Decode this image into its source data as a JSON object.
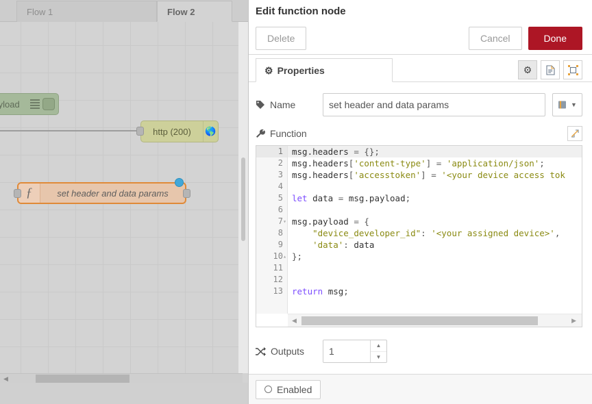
{
  "canvas": {
    "tabs": [
      {
        "label": "Flow 1",
        "active": false
      },
      {
        "label": "Flow 2",
        "active": true
      }
    ],
    "nodes": {
      "debug": {
        "label": "msg.payload",
        "icon": "debug-lines-icon",
        "color": "#a5b99a"
      },
      "http": {
        "label": "http (200)",
        "icon": "globe-icon",
        "color": "#cdd09a"
      },
      "function": {
        "label": "set header and data params",
        "icon": "function-f-icon",
        "color": "#e7c6ac",
        "selected": true
      }
    }
  },
  "dialog": {
    "title": "Edit function node",
    "toolbar": {
      "delete_label": "Delete",
      "cancel_label": "Cancel",
      "done_label": "Done",
      "done_color": "#ad1625"
    },
    "tabs": [
      {
        "label": "Properties",
        "icon": "gear-icon",
        "active": true
      }
    ],
    "tab_icons": [
      {
        "name": "gear-icon",
        "glyph": "⚙",
        "active": true
      },
      {
        "name": "description-icon",
        "glyph": "Ὄ4",
        "active": false
      },
      {
        "name": "appearance-icon",
        "glyph": "⧉",
        "active": false
      }
    ],
    "name_field": {
      "label": "Name",
      "icon": "tag-icon",
      "value": "set header and data params",
      "placeholder": "Name",
      "library_button_icon": "book-icon"
    },
    "function_field": {
      "label": "Function",
      "icon": "wrench-icon",
      "expand_icon": "expand-icon"
    },
    "outputs_field": {
      "label": "Outputs",
      "icon": "shuffle-icon",
      "value": "1"
    },
    "footer": {
      "enabled_label": "Enabled",
      "enabled_icon": "circle-icon"
    }
  },
  "code": {
    "lines": [
      {
        "n": "1",
        "fold": "",
        "current": true,
        "tokens": [
          {
            "t": "msg.headers ",
            "c": ""
          },
          {
            "t": "= ",
            "c": "op"
          },
          {
            "t": "{};",
            "c": "p"
          }
        ],
        "text": "msg.headers = {};"
      },
      {
        "n": "2",
        "fold": "",
        "current": false,
        "tokens": [
          {
            "t": "msg.headers",
            "c": ""
          },
          {
            "t": "[",
            "c": "p"
          },
          {
            "t": "'content-type'",
            "c": "s"
          },
          {
            "t": "] ",
            "c": "p"
          },
          {
            "t": "= ",
            "c": "op"
          },
          {
            "t": "'application/json'",
            "c": "s"
          },
          {
            "t": ";",
            "c": "p"
          }
        ],
        "text": "msg.headers['content-type'] = 'application/json';"
      },
      {
        "n": "3",
        "fold": "",
        "current": false,
        "tokens": [
          {
            "t": "msg.headers",
            "c": ""
          },
          {
            "t": "[",
            "c": "p"
          },
          {
            "t": "'accesstoken'",
            "c": "s"
          },
          {
            "t": "] ",
            "c": "p"
          },
          {
            "t": "= ",
            "c": "op"
          },
          {
            "t": "'<your device access tok",
            "c": "s"
          }
        ],
        "text": "msg.headers['accesstoken'] = '<your device access tok"
      },
      {
        "n": "4",
        "fold": "",
        "current": false,
        "tokens": [],
        "text": ""
      },
      {
        "n": "5",
        "fold": "",
        "current": false,
        "tokens": [
          {
            "t": "let ",
            "c": "k"
          },
          {
            "t": "data ",
            "c": ""
          },
          {
            "t": "= ",
            "c": "op"
          },
          {
            "t": "msg.payload",
            "c": ""
          },
          {
            "t": ";",
            "c": "p"
          }
        ],
        "text": "let data = msg.payload;"
      },
      {
        "n": "6",
        "fold": "",
        "current": false,
        "tokens": [],
        "text": ""
      },
      {
        "n": "7",
        "fold": "▾",
        "current": false,
        "tokens": [
          {
            "t": "msg.payload ",
            "c": ""
          },
          {
            "t": "= ",
            "c": "op"
          },
          {
            "t": "{",
            "c": "p"
          }
        ],
        "text": "msg.payload = {"
      },
      {
        "n": "8",
        "fold": "",
        "current": false,
        "tokens": [
          {
            "t": "    ",
            "c": ""
          },
          {
            "t": "\"device_developer_id\"",
            "c": "s"
          },
          {
            "t": ": ",
            "c": "p"
          },
          {
            "t": "'<your assigned device>'",
            "c": "s"
          },
          {
            "t": ",",
            "c": "p"
          }
        ],
        "text": "    \"device_developer_id\": '<your assigned device>',"
      },
      {
        "n": "9",
        "fold": "",
        "current": false,
        "tokens": [
          {
            "t": "    ",
            "c": ""
          },
          {
            "t": "'data'",
            "c": "s"
          },
          {
            "t": ": ",
            "c": "p"
          },
          {
            "t": "data",
            "c": ""
          }
        ],
        "text": "    'data': data"
      },
      {
        "n": "10",
        "fold": "▴",
        "current": false,
        "tokens": [
          {
            "t": "};",
            "c": "p"
          }
        ],
        "text": "};"
      },
      {
        "n": "11",
        "fold": "",
        "current": false,
        "tokens": [],
        "text": ""
      },
      {
        "n": "12",
        "fold": "",
        "current": false,
        "tokens": [],
        "text": ""
      },
      {
        "n": "13",
        "fold": "",
        "current": false,
        "tokens": [
          {
            "t": "return ",
            "c": "k"
          },
          {
            "t": "msg",
            "c": ""
          },
          {
            "t": ";",
            "c": "p"
          }
        ],
        "text": "return msg;"
      }
    ]
  }
}
